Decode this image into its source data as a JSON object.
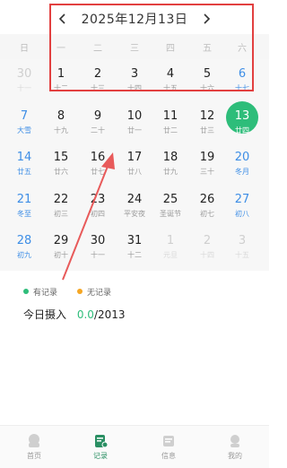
{
  "header": {
    "title": "2025年12月13日"
  },
  "weekdays": [
    "日",
    "一",
    "二",
    "三",
    "四",
    "五",
    "六"
  ],
  "days": [
    {
      "n": "30",
      "l": "十一",
      "s": "muted"
    },
    {
      "n": "1",
      "l": "十二"
    },
    {
      "n": "2",
      "l": "十三"
    },
    {
      "n": "3",
      "l": "十四"
    },
    {
      "n": "4",
      "l": "十五"
    },
    {
      "n": "5",
      "l": "十六"
    },
    {
      "n": "6",
      "l": "十七",
      "s": "blue"
    },
    {
      "n": "7",
      "l": "大雪",
      "s": "blue"
    },
    {
      "n": "8",
      "l": "十九"
    },
    {
      "n": "9",
      "l": "二十"
    },
    {
      "n": "10",
      "l": "廿一"
    },
    {
      "n": "11",
      "l": "廿二"
    },
    {
      "n": "12",
      "l": "廿三"
    },
    {
      "n": "13",
      "l": "廿四",
      "s": "today"
    },
    {
      "n": "14",
      "l": "廿五",
      "s": "blue"
    },
    {
      "n": "15",
      "l": "廿六"
    },
    {
      "n": "16",
      "l": "廿七"
    },
    {
      "n": "17",
      "l": "廿八"
    },
    {
      "n": "18",
      "l": "廿九"
    },
    {
      "n": "19",
      "l": "三十"
    },
    {
      "n": "20",
      "l": "冬月",
      "s": "blue"
    },
    {
      "n": "21",
      "l": "冬至",
      "s": "blue"
    },
    {
      "n": "22",
      "l": "初三"
    },
    {
      "n": "23",
      "l": "初四"
    },
    {
      "n": "24",
      "l": "平安夜"
    },
    {
      "n": "25",
      "l": "圣诞节"
    },
    {
      "n": "26",
      "l": "初七"
    },
    {
      "n": "27",
      "l": "初八",
      "s": "blue"
    },
    {
      "n": "28",
      "l": "初九",
      "s": "blue"
    },
    {
      "n": "29",
      "l": "初十"
    },
    {
      "n": "30",
      "l": "十一"
    },
    {
      "n": "31",
      "l": "十二"
    },
    {
      "n": "1",
      "l": "元旦",
      "s": "muted"
    },
    {
      "n": "2",
      "l": "十四",
      "s": "muted"
    },
    {
      "n": "3",
      "l": "十五",
      "s": "muted"
    }
  ],
  "legend": {
    "recorded": "有记录",
    "not_recorded": "无记录",
    "recorded_color": "#2ebd7a",
    "not_recorded_color": "#f5a623"
  },
  "intake": {
    "label": "今日摄入",
    "value": "0.0",
    "total": "/2013"
  },
  "tabs": [
    {
      "label": "首页",
      "icon": "home-icon"
    },
    {
      "label": "记录",
      "icon": "record-icon"
    },
    {
      "label": "信息",
      "icon": "info-icon"
    },
    {
      "label": "我的",
      "icon": "profile-icon"
    }
  ]
}
